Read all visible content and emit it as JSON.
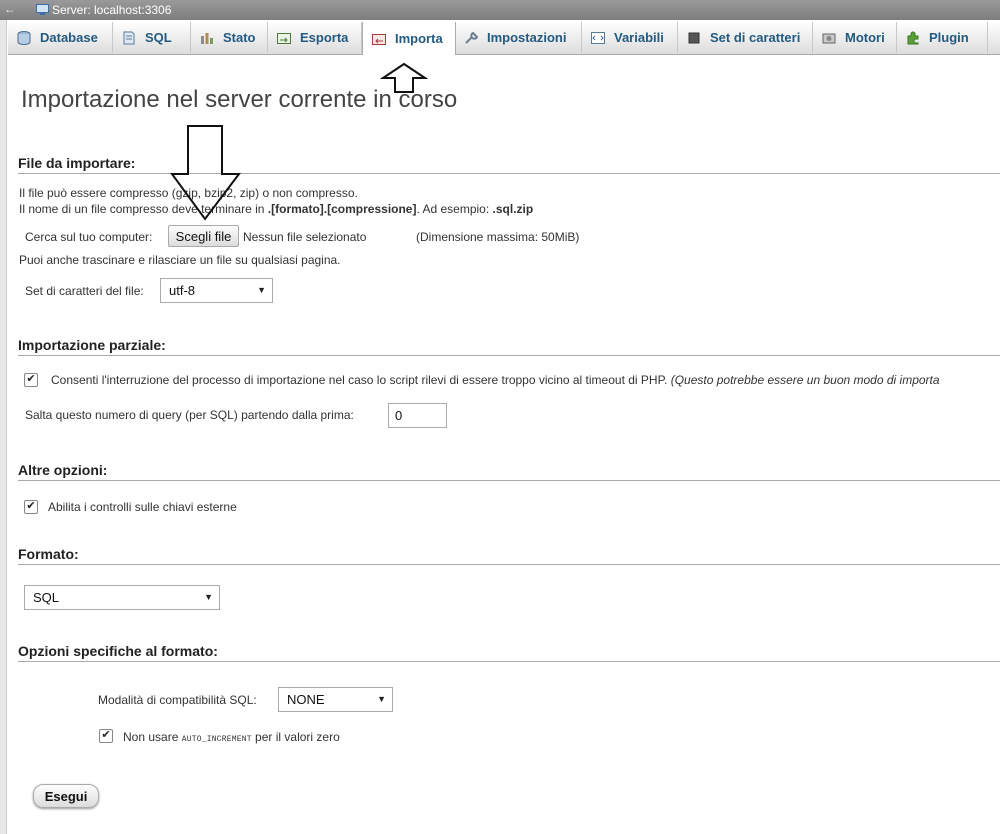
{
  "window": {
    "back_glyph": "←",
    "title": "Server: localhost:3306"
  },
  "tabs": [
    {
      "label": "Database",
      "icon": "database-icon"
    },
    {
      "label": "SQL",
      "icon": "sql-icon"
    },
    {
      "label": "Stato",
      "icon": "status-icon"
    },
    {
      "label": "Esporta",
      "icon": "export-icon"
    },
    {
      "label": "Importa",
      "icon": "import-icon",
      "active": true
    },
    {
      "label": "Impostazioni",
      "icon": "wrench-icon"
    },
    {
      "label": "Variabili",
      "icon": "variables-icon"
    },
    {
      "label": "Set di caratteri",
      "icon": "charset-icon"
    },
    {
      "label": "Motori",
      "icon": "engines-icon"
    },
    {
      "label": "Plugin",
      "icon": "plugin-icon"
    }
  ],
  "page": {
    "title": "Importazione nel server corrente in corso"
  },
  "file_section": {
    "heading": "File da importare:",
    "line1": "Il file può essere compresso (gzip, bzip2, zip) o non compresso.",
    "line2_prefix": "Il nome di un file compresso deve terminare in ",
    "line2_bold": ".[formato].[compressione]",
    "line2_mid": ". Ad esempio: ",
    "line2_example": ".sql.zip",
    "browse_label": "Cerca sul tuo computer:",
    "choose_button": "Scegli file",
    "no_file": "Nessun file selezionato",
    "max_size": "(Dimensione massima: 50MiB)",
    "drag_hint": "Puoi anche trascinare e rilasciare un file su qualsiasi pagina.",
    "charset_label": "Set di caratteri del file:",
    "charset_value": "utf-8"
  },
  "partial_section": {
    "heading": "Importazione parziale:",
    "allow_interrupt": "Consenti l'interruzione del processo di importazione nel caso lo script rilevi di essere troppo vicino al timeout di PHP.",
    "allow_interrupt_note": "(Questo potrebbe essere un buon modo di importa",
    "allow_interrupt_checked": true,
    "skip_label": "Salta questo numero di query (per SQL) partendo dalla prima:",
    "skip_value": "0"
  },
  "other_section": {
    "heading": "Altre opzioni:",
    "fk_checks": "Abilita i controlli sulle chiavi esterne",
    "fk_checks_checked": true
  },
  "format_section": {
    "heading": "Formato:",
    "format_value": "SQL"
  },
  "format_options_section": {
    "heading": "Opzioni specifiche al formato:",
    "compat_label": "Modalità di compatibilità SQL:",
    "compat_value": "NONE",
    "no_auto_prefix": "Non usare ",
    "no_auto_code": "AUTO_INCREMENT",
    "no_auto_suffix": " per il valori zero",
    "no_auto_checked": true
  },
  "submit": {
    "label": "Esegui"
  },
  "annotations": {
    "up_arrow": "arrow-up-annotation",
    "down_arrow": "arrow-down-annotation"
  },
  "colors": {
    "tab_text": "#235a81",
    "title_text": "#444444",
    "titlebar": "#8a8a8a"
  }
}
